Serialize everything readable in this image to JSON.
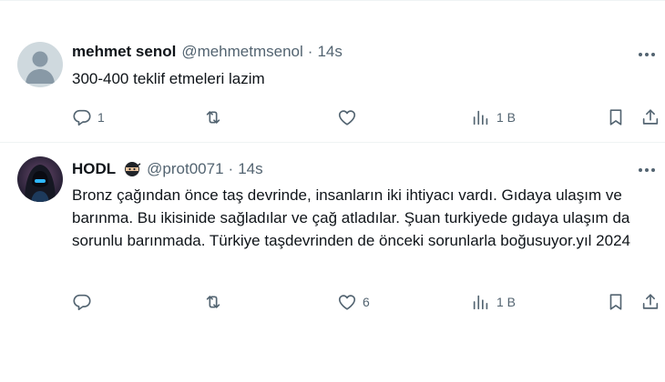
{
  "tweets": [
    {
      "display_name": "mehmet senol",
      "handle": "@mehmetmsenol",
      "separator": "·",
      "time": "14s",
      "text": "300-400 teklif etmeleri lazim",
      "reply_count": "1",
      "retweet_count": "",
      "like_count": "",
      "view_count": "1 B"
    },
    {
      "display_name": "HODL",
      "handle": "@prot0071",
      "separator": "·",
      "time": "14s",
      "text": "Bronz çağından önce taş devrinde, insanların iki ihtiyacı vardı. Gıdaya ulaşım ve barınma. Bu ikisinide sağladılar ve çağ atladılar. Şuan turkiyede gıdaya ulaşım da sorunlu barınmada. Türkiye taşdevrinden de önceki sorunlarla boğusuyor.yıl 2024",
      "reply_count": "",
      "retweet_count": "",
      "like_count": "6",
      "view_count": "1 B"
    }
  ],
  "icons": {
    "reply": "reply-icon",
    "retweet": "retweet-icon",
    "like": "heart-icon",
    "views": "analytics-icon",
    "bookmark": "bookmark-icon",
    "share": "share-icon",
    "more": "more-icon",
    "badge": "ninja-emoji-icon"
  },
  "colors": {
    "text": "#0f1419",
    "muted": "#536471",
    "divider": "#eff3f4"
  }
}
